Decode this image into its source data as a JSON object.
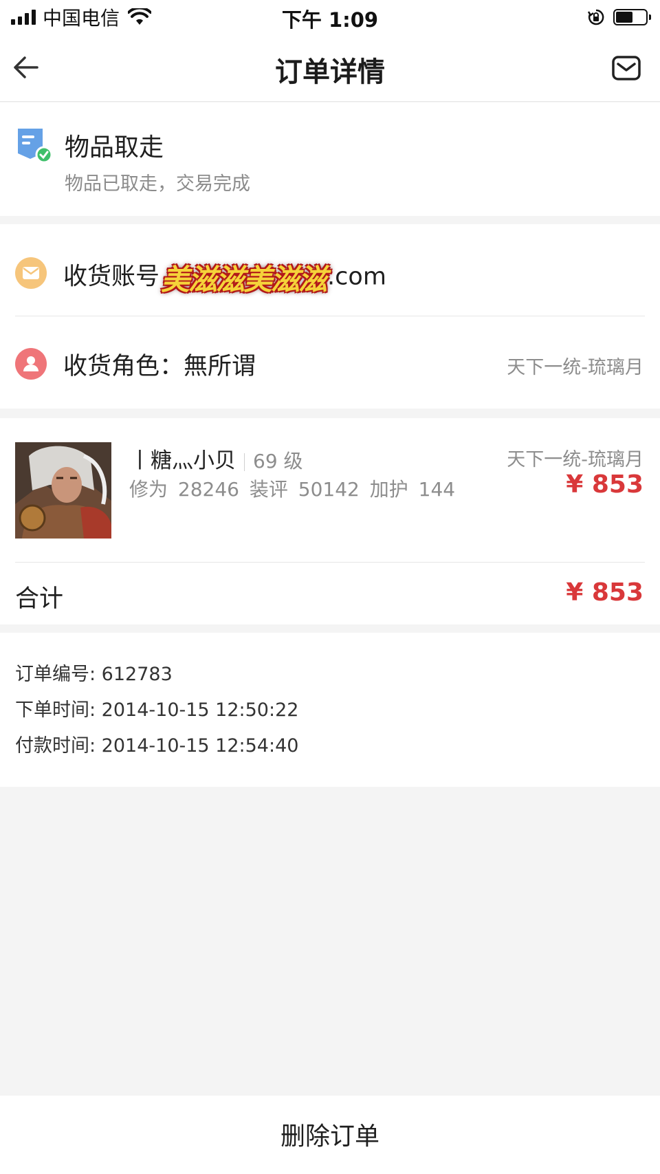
{
  "status_bar": {
    "carrier": "中国电信",
    "time": "下午 1:09"
  },
  "nav": {
    "title": "订单详情",
    "back_icon": "arrow-left-icon",
    "mail_icon": "mail-icon"
  },
  "order_status": {
    "title": "物品取走",
    "subtitle": "物品已取走，交易完成"
  },
  "receiver": {
    "account_label": "收货账号",
    "account_masked": "美滋滋美滋滋",
    "account_suffix": ".com",
    "role_label": "收货角色：無所谓",
    "server": "天下一统-琉璃月"
  },
  "item": {
    "name": "丨糖灬小贝",
    "level": "69 级",
    "stats": "修为 28246  装评 50142  加护 144",
    "server": "天下一统-琉璃月",
    "price": "¥ 853"
  },
  "total": {
    "label": "合计",
    "price": "¥ 853"
  },
  "info": {
    "order_no": "订单编号: 612783",
    "order_time": "下单时间: 2014-10-15 12:50:22",
    "pay_time": "付款时间: 2014-10-15 12:54:40"
  },
  "actions": {
    "delete_label": "删除订单"
  },
  "colors": {
    "price": "#d9383a",
    "mail_icon_bg": "#f6c57b",
    "user_icon_bg": "#ef7579",
    "status_icon": "#4a90e2"
  }
}
